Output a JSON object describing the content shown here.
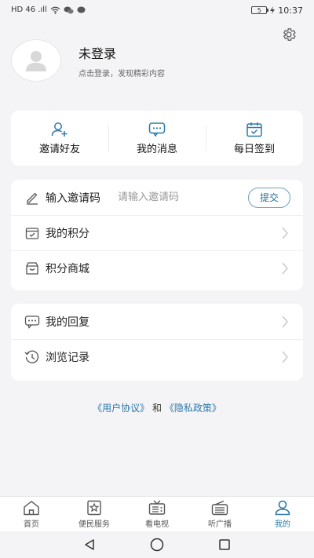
{
  "status_bar": {
    "left_icons": "HD 46 .ıll",
    "battery": "5",
    "time": "10:37"
  },
  "profile": {
    "title": "未登录",
    "subtitle": "点击登录，发现精彩内容"
  },
  "quick_actions": [
    {
      "label": "邀请好友",
      "icon": "add-user-icon"
    },
    {
      "label": "我的消息",
      "icon": "message-icon"
    },
    {
      "label": "每日签到",
      "icon": "calendar-check-icon"
    }
  ],
  "invite": {
    "label": "输入邀请码",
    "placeholder": "请输入邀请码",
    "value": "",
    "submit_label": "提交"
  },
  "list1": [
    {
      "label": "我的积分",
      "icon": "points-icon"
    },
    {
      "label": "积分商城",
      "icon": "store-icon"
    }
  ],
  "list2": [
    {
      "label": "我的回复",
      "icon": "reply-icon"
    },
    {
      "label": "浏览记录",
      "icon": "history-icon"
    }
  ],
  "agreement": {
    "user_agreement": "《用户协议》",
    "and": "和",
    "privacy_policy": "《隐私政策》"
  },
  "tabs": [
    {
      "label": "首页",
      "icon": "home-icon"
    },
    {
      "label": "便民服务",
      "icon": "service-icon"
    },
    {
      "label": "看电视",
      "icon": "tv-icon"
    },
    {
      "label": "听广播",
      "icon": "radio-icon"
    },
    {
      "label": "我的",
      "icon": "user-icon",
      "active": true
    }
  ],
  "colors": {
    "accent": "#2d78a8",
    "background": "#f4f4f6"
  }
}
